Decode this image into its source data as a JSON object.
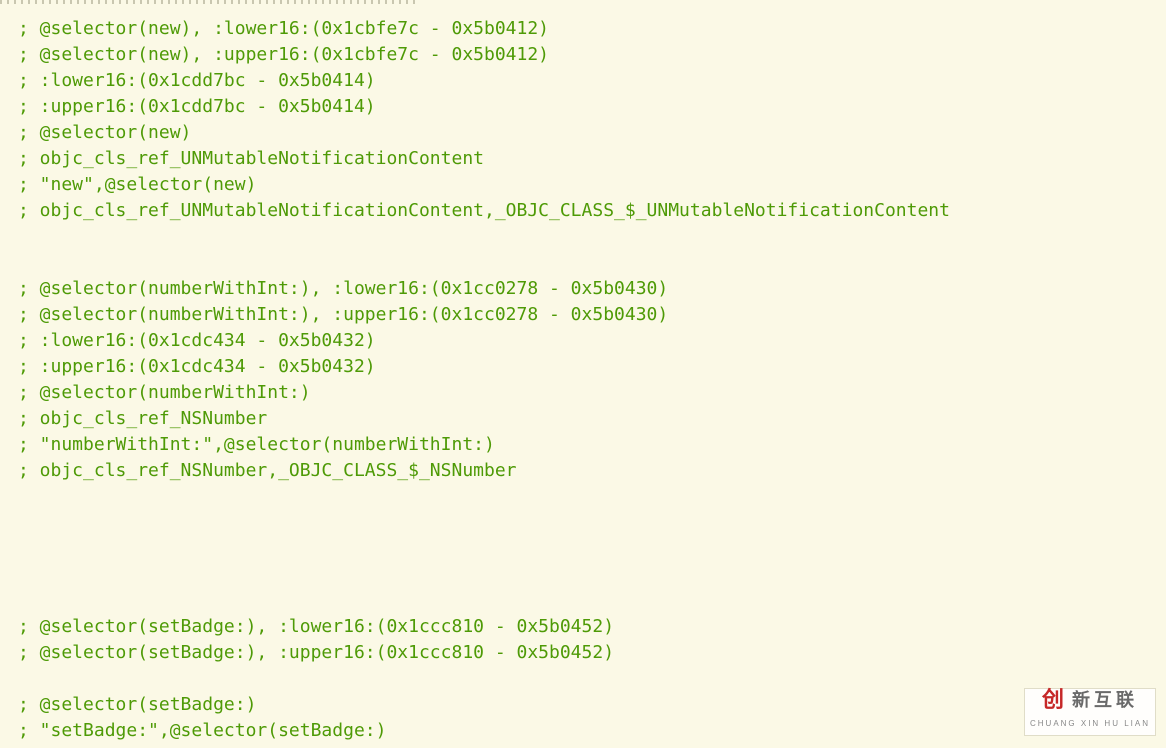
{
  "lines": [
    "; @selector(new), :lower16:(0x1cbfe7c - 0x5b0412)",
    "; @selector(new), :upper16:(0x1cbfe7c - 0x5b0412)",
    "; :lower16:(0x1cdd7bc - 0x5b0414)",
    "; :upper16:(0x1cdd7bc - 0x5b0414)",
    "; @selector(new)",
    "; objc_cls_ref_UNMutableNotificationContent",
    "; \"new\",@selector(new)",
    "; objc_cls_ref_UNMutableNotificationContent,_OBJC_CLASS_$_UNMutableNotificationContent",
    "",
    "",
    "; @selector(numberWithInt:), :lower16:(0x1cc0278 - 0x5b0430)",
    "; @selector(numberWithInt:), :upper16:(0x1cc0278 - 0x5b0430)",
    "; :lower16:(0x1cdc434 - 0x5b0432)",
    "; :upper16:(0x1cdc434 - 0x5b0432)",
    "; @selector(numberWithInt:)",
    "; objc_cls_ref_NSNumber",
    "; \"numberWithInt:\",@selector(numberWithInt:)",
    "; objc_cls_ref_NSNumber,_OBJC_CLASS_$_NSNumber",
    "",
    "",
    "",
    "",
    "",
    "; @selector(setBadge:), :lower16:(0x1ccc810 - 0x5b0452)",
    "; @selector(setBadge:), :upper16:(0x1ccc810 - 0x5b0452)",
    "",
    "; @selector(setBadge:)",
    "; \"setBadge:\",@selector(setBadge:)"
  ],
  "watermark": {
    "top_prefix": "创",
    "top_rest": "新互联",
    "bottom": "CHUANG XIN HU LIAN"
  }
}
